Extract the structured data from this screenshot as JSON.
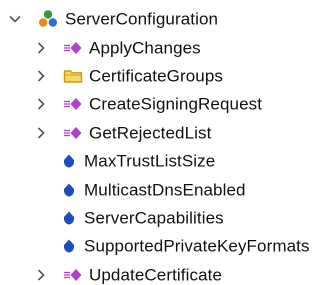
{
  "tree": {
    "root": {
      "label": "ServerConfiguration",
      "icon": "server-object-icon",
      "expanded": true
    },
    "children": [
      {
        "label": "ApplyChanges",
        "icon": "method-icon",
        "expandable": true
      },
      {
        "label": "CertificateGroups",
        "icon": "folder-icon",
        "expandable": true
      },
      {
        "label": "CreateSigningRequest",
        "icon": "method-icon",
        "expandable": true
      },
      {
        "label": "GetRejectedList",
        "icon": "method-icon",
        "expandable": true
      },
      {
        "label": "MaxTrustListSize",
        "icon": "property-icon",
        "expandable": false
      },
      {
        "label": "MulticastDnsEnabled",
        "icon": "property-icon",
        "expandable": false
      },
      {
        "label": "ServerCapabilities",
        "icon": "property-icon",
        "expandable": false
      },
      {
        "label": "SupportedPrivateKeyFormats",
        "icon": "property-icon",
        "expandable": false
      },
      {
        "label": "UpdateCertificate",
        "icon": "method-icon",
        "expandable": true
      }
    ]
  },
  "colors": {
    "chevron": "#555555",
    "method_icon": "#b040c8",
    "folder_outline": "#c89a18",
    "folder_fill": "#f6d86a",
    "property_icon": "#1d4fb8",
    "object_green": "#2e9b3a",
    "object_orange": "#e8881a",
    "object_blue": "#2d6fd6"
  }
}
